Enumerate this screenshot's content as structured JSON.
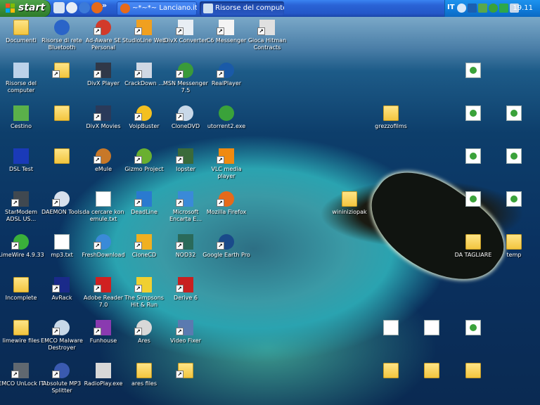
{
  "taskbar": {
    "start_label": "start",
    "quick_launch_more": "»",
    "tasks": [
      {
        "label": "~*~*~ Lanciano.it ~..."
      },
      {
        "label": "Risorse del computer"
      }
    ],
    "tray": {
      "language": "IT",
      "clock": "19.11"
    }
  },
  "desktop": {
    "icons": [
      {
        "label": "Documenti",
        "icon": "folder-icon"
      },
      {
        "label": "Risorse di rete Bluetooth",
        "icon": "bluetooth-icon"
      },
      {
        "label": "Ad-Aware SE Personal",
        "icon": "ad-aware-icon"
      },
      {
        "label": "StudioLine Web",
        "icon": "studioline-icon"
      },
      {
        "label": "DivX Converter",
        "icon": "divx-converter-icon"
      },
      {
        "label": "C6 Messenger",
        "icon": "c6-messenger-icon"
      },
      {
        "label": "Gioca Hitman Contracts",
        "icon": "hitman-icon"
      },
      {
        "label": "Risorse del computer",
        "icon": "computer-icon"
      },
      {
        "label": "",
        "icon": "folder-icon"
      },
      {
        "label": "DivX Player",
        "icon": "divx-player-icon"
      },
      {
        "label": "CrackDown ...",
        "icon": "crackdown-icon"
      },
      {
        "label": "MSN Messenger 7.5",
        "icon": "msn-icon"
      },
      {
        "label": "RealPlayer",
        "icon": "realplayer-icon"
      },
      {
        "label": "",
        "icon": "utorrent-file-icon"
      },
      {
        "label": "Cestino",
        "icon": "recycle-bin-icon"
      },
      {
        "label": "",
        "icon": "folder-icon"
      },
      {
        "label": "DivX Movies",
        "icon": "divx-movies-icon"
      },
      {
        "label": "VoipBuster",
        "icon": "voipbuster-icon"
      },
      {
        "label": "CloneDVD",
        "icon": "clonedvd-icon"
      },
      {
        "label": "utorrent2.exe",
        "icon": "utorrent-icon"
      },
      {
        "label": "grezzofilms",
        "icon": "folder-icon"
      },
      {
        "label": "",
        "icon": "utorrent-file-icon"
      },
      {
        "label": "",
        "icon": "utorrent-file-icon"
      },
      {
        "label": "DSL Test",
        "icon": "dsl-test-icon"
      },
      {
        "label": "",
        "icon": "folder-icon"
      },
      {
        "label": "eMule",
        "icon": "emule-icon"
      },
      {
        "label": "Gizmo Project",
        "icon": "gizmo-icon"
      },
      {
        "label": "lopster",
        "icon": "lopster-icon"
      },
      {
        "label": "VLC media player",
        "icon": "vlc-icon"
      },
      {
        "label": "",
        "icon": "utorrent-file-icon"
      },
      {
        "label": "",
        "icon": "utorrent-file-icon"
      },
      {
        "label": "StarModem ADSL US...",
        "icon": "starmodem-icon"
      },
      {
        "label": "DAEMON Tools",
        "icon": "daemon-tools-icon"
      },
      {
        "label": "da cercare kon emule.txt",
        "icon": "text-file-icon"
      },
      {
        "label": "DeadLine",
        "icon": "deadline-icon"
      },
      {
        "label": "Microsoft Encarta E...",
        "icon": "encarta-icon"
      },
      {
        "label": "Mozilla Firefox",
        "icon": "firefox-icon"
      },
      {
        "label": "wininiziopak",
        "icon": "folder-icon"
      },
      {
        "label": "",
        "icon": "utorrent-file-icon"
      },
      {
        "label": "",
        "icon": "utorrent-file-icon"
      },
      {
        "label": "LimeWire 4.9.33",
        "icon": "limewire-icon"
      },
      {
        "label": "mp3.txt",
        "icon": "text-file-icon"
      },
      {
        "label": "FreshDownload",
        "icon": "freshdownload-icon"
      },
      {
        "label": "CloneCD",
        "icon": "clonecd-icon"
      },
      {
        "label": "NOD32",
        "icon": "nod32-icon"
      },
      {
        "label": "Google Earth Pro",
        "icon": "google-earth-icon"
      },
      {
        "label": "DA TAGLIARE",
        "icon": "folder-icon"
      },
      {
        "label": "temp",
        "icon": "folder-icon"
      },
      {
        "label": "Incomplete",
        "icon": "folder-icon"
      },
      {
        "label": "AvRack",
        "icon": "avrack-icon"
      },
      {
        "label": "Adobe Reader 7.0",
        "icon": "adobe-reader-icon"
      },
      {
        "label": "The Simpsons Hit & Run",
        "icon": "simpsons-icon"
      },
      {
        "label": "Derive 6",
        "icon": "derive-icon"
      },
      {
        "label": "limewire files",
        "icon": "folder-icon"
      },
      {
        "label": "EMCO Malware Destroyer",
        "icon": "emco-malware-icon"
      },
      {
        "label": "Funhouse",
        "icon": "funhouse-icon"
      },
      {
        "label": "Ares",
        "icon": "ares-icon"
      },
      {
        "label": "Video Fixer",
        "icon": "video-fixer-icon"
      },
      {
        "label": "",
        "icon": "document-file-icon"
      },
      {
        "label": "",
        "icon": "document-file-icon"
      },
      {
        "label": "",
        "icon": "utorrent-file-icon"
      },
      {
        "label": "EMCO UnLock IT",
        "icon": "emco-unlock-icon"
      },
      {
        "label": "Absolute MP3 Splitter",
        "icon": "mp3-splitter-icon"
      },
      {
        "label": "RadioPlay.exe",
        "icon": "radioplay-icon"
      },
      {
        "label": "ares files",
        "icon": "folder-icon"
      },
      {
        "label": "",
        "icon": "folder-icon"
      },
      {
        "label": "",
        "icon": "folder-icon"
      },
      {
        "label": "",
        "icon": "folder-icon"
      },
      {
        "label": "",
        "icon": "folder-icon"
      }
    ]
  },
  "colors": {
    "taskbar": "#2457c8",
    "start": "#3c8f38",
    "tray": "#0f7ad8",
    "folder": "#f2c43c"
  }
}
